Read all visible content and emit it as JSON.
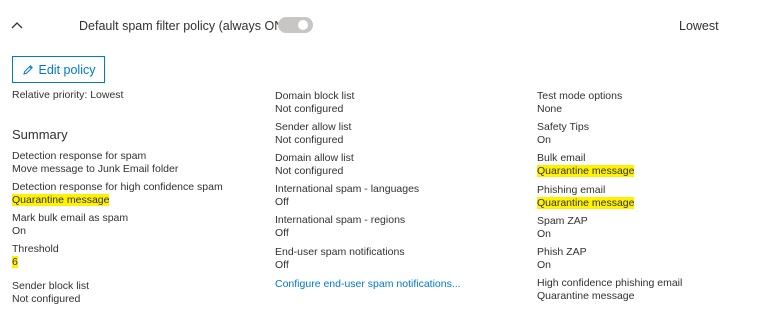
{
  "header": {
    "policy_name": "Default spam filter policy (always ON)",
    "priority": "Lowest",
    "toggle_state": "on-disabled",
    "collapse_icon": "chevron-up-icon"
  },
  "actions": {
    "edit_label": "Edit policy",
    "edit_icon": "pencil-icon"
  },
  "relative_priority": "Relative priority: Lowest",
  "summary_title": "Summary",
  "columns": {
    "left": [
      {
        "label": "Detection response for spam",
        "value": "Move message to Junk Email folder",
        "highlight": false
      },
      {
        "label": "Detection response for high confidence spam",
        "value": "Quarantine message",
        "highlight": true
      },
      {
        "label": "Mark bulk email as spam",
        "value": "On",
        "highlight": false
      },
      {
        "label": "Threshold",
        "value": "6",
        "highlight": true
      },
      {
        "label": "Sender block list",
        "value": "Not configured",
        "highlight": false
      }
    ],
    "middle": [
      {
        "label": "Domain block list",
        "value": "Not configured"
      },
      {
        "label": "Sender allow list",
        "value": "Not configured"
      },
      {
        "label": "Domain allow list",
        "value": "Not configured"
      },
      {
        "label": "International spam - languages",
        "value": "Off"
      },
      {
        "label": "International spam - regions",
        "value": "Off"
      },
      {
        "label": "End-user spam notifications",
        "value": "Off"
      }
    ],
    "middle_link": "Configure end-user spam notifications...",
    "right": [
      {
        "label": "Test mode options",
        "value": "None",
        "highlight": false
      },
      {
        "label": "Safety Tips",
        "value": "On",
        "highlight": false
      },
      {
        "label": "Bulk email",
        "value": "Quarantine message",
        "highlight": true
      },
      {
        "label": "Phishing email",
        "value": "Quarantine message",
        "highlight": true
      },
      {
        "label": "Spam ZAP",
        "value": "On",
        "highlight": false
      },
      {
        "label": "Phish ZAP",
        "value": "On",
        "highlight": false
      },
      {
        "label": "High confidence phishing email",
        "value": "Quarantine message",
        "highlight": false
      }
    ]
  },
  "colors": {
    "accent": "#0078d4",
    "highlight": "#fff200",
    "toggle_off": "#c8c6c4",
    "text": "#323130"
  }
}
